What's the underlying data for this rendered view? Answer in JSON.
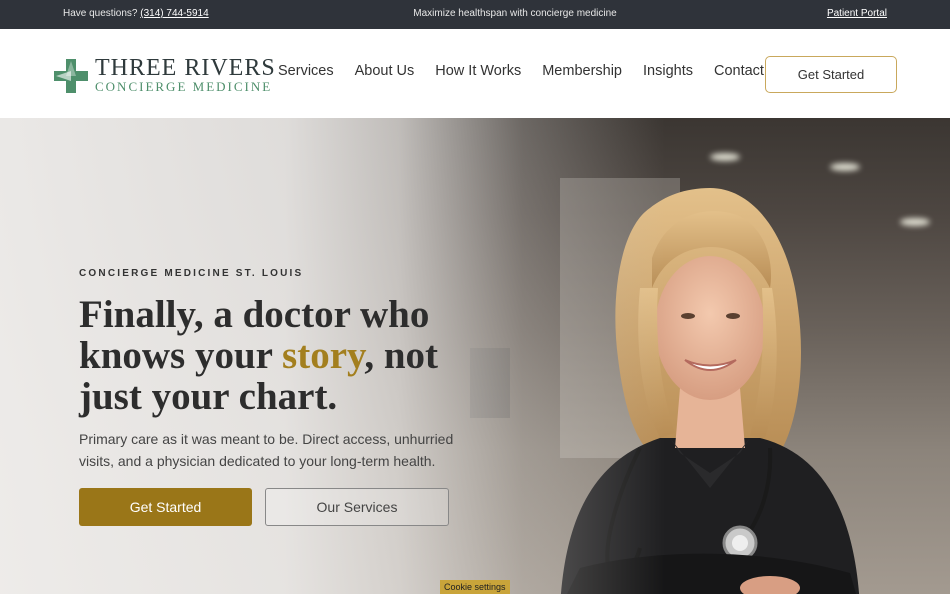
{
  "topbar": {
    "questions_label": "Have questions?",
    "phone": "(314) 744-5914",
    "tagline": "Maximize healthspan with concierge medicine",
    "portal_link": "Patient Portal"
  },
  "header": {
    "logo_name": "THREE RIVERS",
    "logo_tag": "CONCIERGE MEDICINE",
    "nav": [
      "Services",
      "About Us",
      "How It Works",
      "Membership",
      "Insights",
      "Contact"
    ],
    "cta": "Get Started"
  },
  "hero": {
    "eyebrow": "CONCIERGE MEDICINE ST. LOUIS",
    "headline_pre": "Finally, a doctor who knows your ",
    "headline_accent": "story",
    "headline_post": ", not just your chart.",
    "lede": "Primary care as it was meant to be. Direct access, unhurried visits, and a physician dedicated to your long-term health.",
    "primary_button": "Get Started",
    "secondary_button": "Our Services"
  },
  "cookie": {
    "label": "Cookie settings"
  },
  "colors": {
    "accent": "#9a7618",
    "logo_green": "#4e8f6b",
    "topbar": "#2f333a"
  }
}
